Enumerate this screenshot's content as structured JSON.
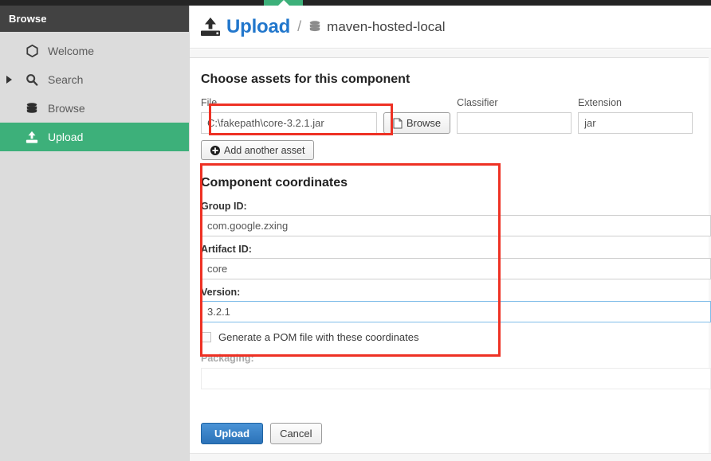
{
  "sidebar": {
    "header_title": "Browse",
    "items": [
      {
        "label": "Welcome",
        "icon": "hexagon-icon",
        "active": false,
        "expandable": false
      },
      {
        "label": "Search",
        "icon": "search-icon",
        "active": false,
        "expandable": true
      },
      {
        "label": "Browse",
        "icon": "database-icon",
        "active": false,
        "expandable": false
      },
      {
        "label": "Upload",
        "icon": "upload-icon",
        "active": true,
        "expandable": false
      }
    ]
  },
  "header": {
    "upload_icon": "upload-icon",
    "title": "Upload",
    "separator": "/",
    "repo_icon": "database-icon",
    "repository": "maven-hosted-local"
  },
  "assets": {
    "section_title": "Choose assets for this component",
    "file_label": "File",
    "file_value": "C:\\fakepath\\core-3.2.1.jar",
    "file_placeholder": "",
    "browse_label": "Browse",
    "browse_icon": "file-icon",
    "classifier_label": "Classifier",
    "classifier_value": "",
    "classifier_placeholder": "",
    "extension_label": "Extension",
    "extension_value": "jar",
    "extension_placeholder": "",
    "add_another_label": "Add another asset",
    "add_another_icon": "plus-circle-icon"
  },
  "coordinates": {
    "section_title": "Component coordinates",
    "group_id_label": "Group ID:",
    "group_id_value": "com.google.zxing",
    "artifact_id_label": "Artifact ID:",
    "artifact_id_value": "core",
    "version_label": "Version:",
    "version_value": "3.2.1",
    "generate_pom_label": "Generate a POM file with these coordinates",
    "generate_pom_checked": false,
    "packaging_label": "Packaging:",
    "packaging_value": ""
  },
  "actions": {
    "upload_label": "Upload",
    "cancel_label": "Cancel"
  },
  "colors": {
    "accent_green": "#3db07a",
    "link_blue": "#2277cc",
    "primary_button": "#2b72b8",
    "annotation_red": "#ee3124",
    "sidebar_bg": "#dcdcdc",
    "sidebar_header_bg": "#424242",
    "focus_border": "#7fbde8"
  }
}
